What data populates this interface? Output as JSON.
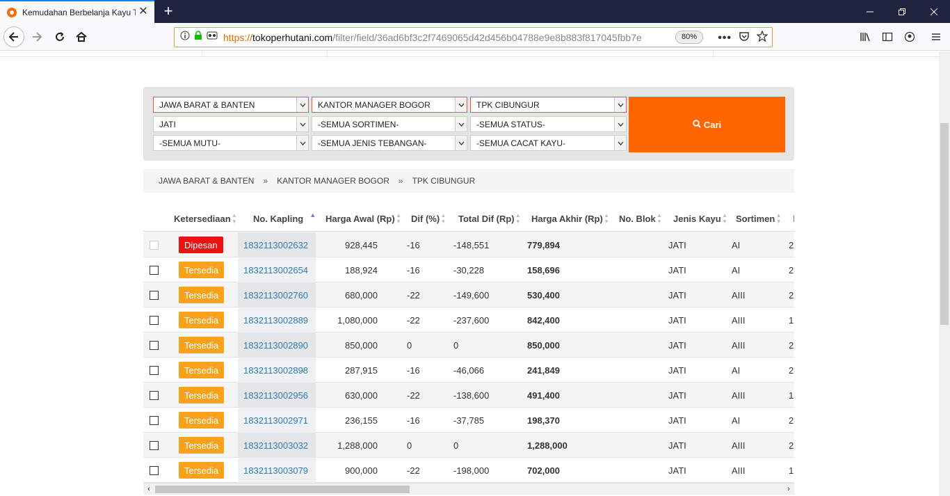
{
  "browser": {
    "tab_title": "Kemudahan Berbelanja Kayu Te",
    "url_scheme": "https://",
    "url_host": "tokoperhutani.com",
    "url_path": "/filter/field/36ad6bf3c2f7469065d42d456b04788e9e8b883f817045fbb7e",
    "zoom": "80%",
    "accent_color": "#0a84ff",
    "titlebar_color": "#202340"
  },
  "filters": {
    "row1": [
      "JAWA BARAT & BANTEN",
      "KANTOR MANAGER BOGOR",
      "TPK CIBUNGUR"
    ],
    "row2": [
      "JATI",
      "-SEMUA SORTIMEN-",
      "-SEMUA STATUS-"
    ],
    "row3": [
      "-SEMUA MUTU-",
      "-SEMUA JENIS TEBANGAN-",
      "-SEMUA CACAT KAYU-"
    ],
    "search_button": "Cari",
    "search_button_color": "#ff6600"
  },
  "breadcrumb": [
    "JAWA BARAT & BANTEN",
    "KANTOR MANAGER BOGOR",
    "TPK CIBUNGUR"
  ],
  "breadcrumb_separator": "»",
  "table": {
    "headers": [
      "Ketersediaan",
      "No. Kapling",
      "Harga Awal (Rp)",
      "Dif (%)",
      "Total Dif (Rp)",
      "Harga Akhir (Rp)",
      "No. Blok",
      "Jenis Kayu",
      "Sortimen"
    ],
    "sorted_column": "No. Kapling",
    "rows": [
      {
        "status": "Dipesan",
        "kapling": "1832113002632",
        "harga_awal": "928,445",
        "dif": "-16",
        "total_dif": "-148,551",
        "harga_akhir": "779,894",
        "blok": "",
        "jenis": "JATI",
        "sortimen": "AI",
        "next": "2"
      },
      {
        "status": "Tersedia",
        "kapling": "1832113002654",
        "harga_awal": "188,924",
        "dif": "-16",
        "total_dif": "-30,228",
        "harga_akhir": "158,696",
        "blok": "",
        "jenis": "JATI",
        "sortimen": "AI",
        "next": "2"
      },
      {
        "status": "Tersedia",
        "kapling": "1832113002760",
        "harga_awal": "680,000",
        "dif": "-22",
        "total_dif": "-149,600",
        "harga_akhir": "530,400",
        "blok": "",
        "jenis": "JATI",
        "sortimen": "AIII",
        "next": "2"
      },
      {
        "status": "Tersedia",
        "kapling": "1832113002889",
        "harga_awal": "1,080,000",
        "dif": "-22",
        "total_dif": "-237,600",
        "harga_akhir": "842,400",
        "blok": "",
        "jenis": "JATI",
        "sortimen": "AIII",
        "next": "1"
      },
      {
        "status": "Tersedia",
        "kapling": "1832113002890",
        "harga_awal": "850,000",
        "dif": "0",
        "total_dif": "0",
        "harga_akhir": "850,000",
        "blok": "",
        "jenis": "JATI",
        "sortimen": "AIII",
        "next": "2"
      },
      {
        "status": "Tersedia",
        "kapling": "1832113002898",
        "harga_awal": "287,915",
        "dif": "-16",
        "total_dif": "-46,066",
        "harga_akhir": "241,849",
        "blok": "",
        "jenis": "JATI",
        "sortimen": "AI",
        "next": "2"
      },
      {
        "status": "Tersedia",
        "kapling": "1832113002956",
        "harga_awal": "630,000",
        "dif": "-22",
        "total_dif": "-138,600",
        "harga_akhir": "491,400",
        "blok": "",
        "jenis": "JATI",
        "sortimen": "AIII",
        "next": "1"
      },
      {
        "status": "Tersedia",
        "kapling": "1832113002971",
        "harga_awal": "236,155",
        "dif": "-16",
        "total_dif": "-37,785",
        "harga_akhir": "198,370",
        "blok": "",
        "jenis": "JATI",
        "sortimen": "AI",
        "next": "2"
      },
      {
        "status": "Tersedia",
        "kapling": "1832113003032",
        "harga_awal": "1,288,000",
        "dif": "0",
        "total_dif": "0",
        "harga_akhir": "1,288,000",
        "blok": "",
        "jenis": "JATI",
        "sortimen": "AIII",
        "next": "2"
      },
      {
        "status": "Tersedia",
        "kapling": "1832113003079",
        "harga_awal": "900,000",
        "dif": "-22",
        "total_dif": "-198,000",
        "harga_akhir": "702,000",
        "blok": "",
        "jenis": "JATI",
        "sortimen": "AIII",
        "next": "1"
      }
    ],
    "status_colors": {
      "Tersedia": "#f9a11b",
      "Dipesan": "#ee1111"
    }
  }
}
